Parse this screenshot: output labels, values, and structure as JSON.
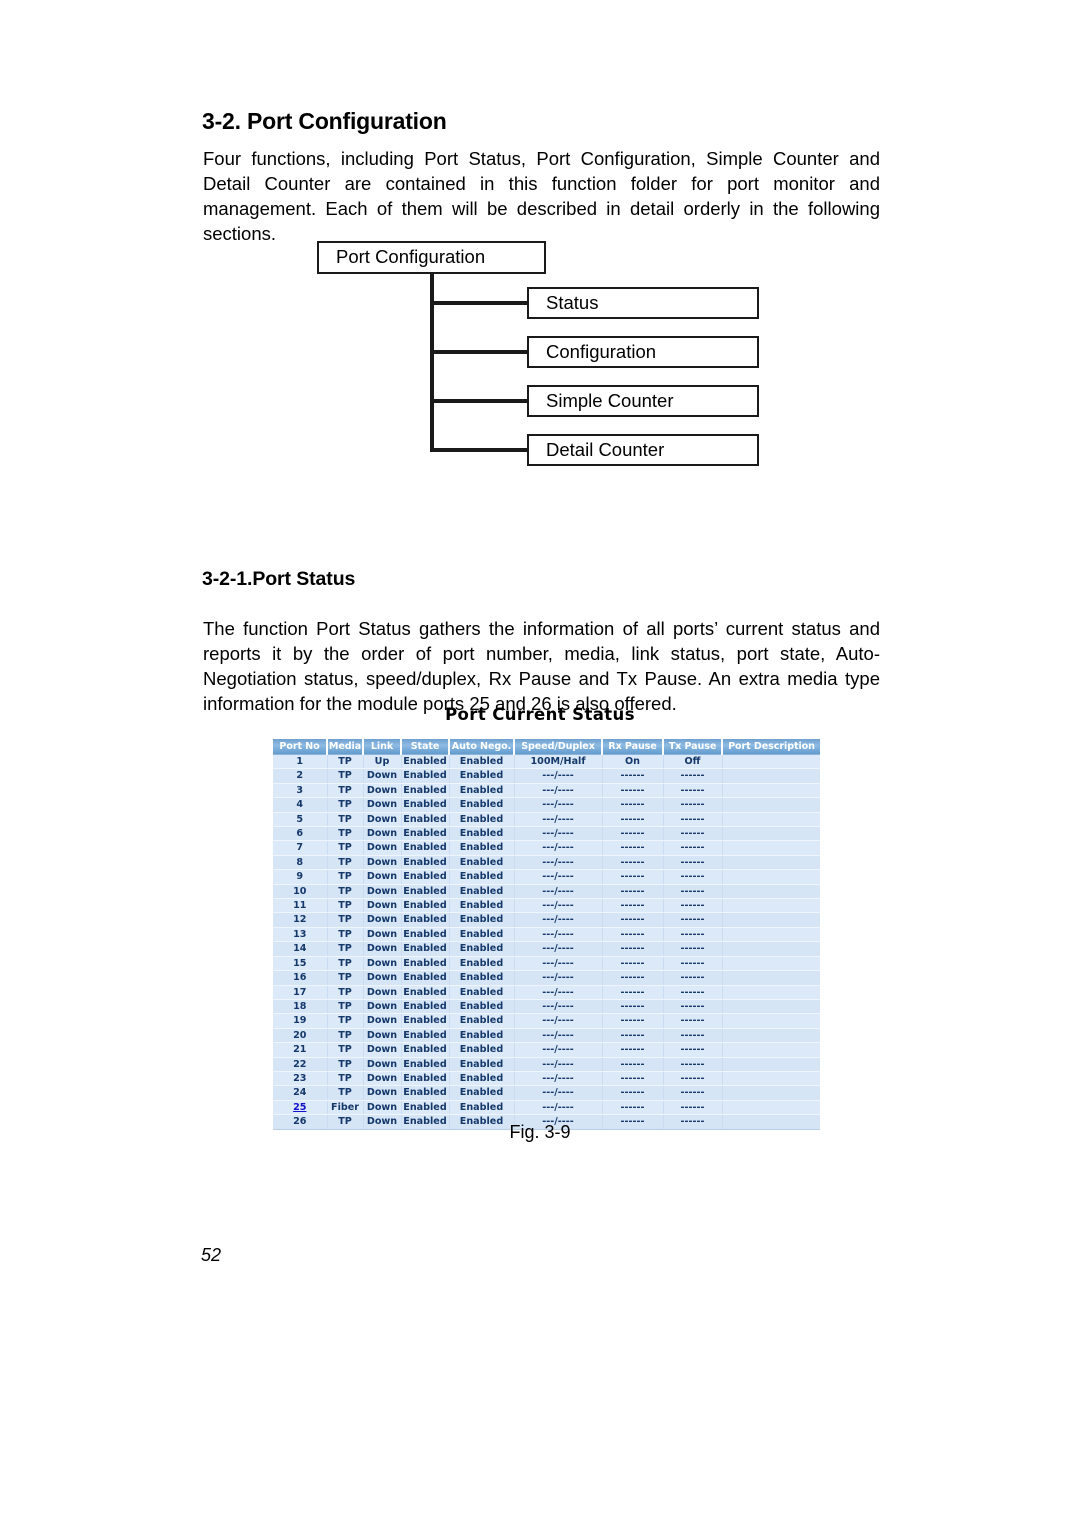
{
  "document": {
    "section_heading": "3-2. Port Configuration",
    "intro_paragraph": "Four functions, including Port Status, Port Configuration, Simple Counter and Detail Counter are contained in this function folder for port monitor and management. Each of them will be described in detail orderly in the following sections.",
    "subsection_heading": "3-2-1.Port Status",
    "status_paragraph": "The function Port Status gathers the information of all ports’ current status and reports it by the order of port number, media, link status, port state, Auto-Negotiation status, speed/duplex, Rx Pause and Tx Pause. An extra media type information for the module ports 25 and 26 is also offered.",
    "figure_caption": "Fig. 3-9",
    "page_number": "52"
  },
  "diagram": {
    "root": "Port Configuration",
    "children": [
      {
        "label": "Status"
      },
      {
        "label": "Configuration"
      },
      {
        "label": "Simple Counter"
      },
      {
        "label": "Detail Counter"
      }
    ]
  },
  "figure": {
    "title": "Port Current Status",
    "table": {
      "columns": [
        "Port No",
        "Media",
        "Link",
        "State",
        "Auto Nego.",
        "Speed/Duplex",
        "Rx Pause",
        "Tx Pause",
        "Port Description"
      ],
      "link_color": "#1111cc",
      "header_color": "#7fb0dc",
      "row_color": "#dce9f8",
      "rows": [
        {
          "port": "1",
          "media": "TP",
          "link": "Up",
          "state": "Enabled",
          "auto": "Enabled",
          "speed": "100M/Half",
          "rx": "On",
          "tx": "Off",
          "desc": "",
          "is_link": false
        },
        {
          "port": "2",
          "media": "TP",
          "link": "Down",
          "state": "Enabled",
          "auto": "Enabled",
          "speed": "---/----",
          "rx": "------",
          "tx": "------",
          "desc": "",
          "is_link": false
        },
        {
          "port": "3",
          "media": "TP",
          "link": "Down",
          "state": "Enabled",
          "auto": "Enabled",
          "speed": "---/----",
          "rx": "------",
          "tx": "------",
          "desc": "",
          "is_link": false
        },
        {
          "port": "4",
          "media": "TP",
          "link": "Down",
          "state": "Enabled",
          "auto": "Enabled",
          "speed": "---/----",
          "rx": "------",
          "tx": "------",
          "desc": "",
          "is_link": false
        },
        {
          "port": "5",
          "media": "TP",
          "link": "Down",
          "state": "Enabled",
          "auto": "Enabled",
          "speed": "---/----",
          "rx": "------",
          "tx": "------",
          "desc": "",
          "is_link": false
        },
        {
          "port": "6",
          "media": "TP",
          "link": "Down",
          "state": "Enabled",
          "auto": "Enabled",
          "speed": "---/----",
          "rx": "------",
          "tx": "------",
          "desc": "",
          "is_link": false
        },
        {
          "port": "7",
          "media": "TP",
          "link": "Down",
          "state": "Enabled",
          "auto": "Enabled",
          "speed": "---/----",
          "rx": "------",
          "tx": "------",
          "desc": "",
          "is_link": false
        },
        {
          "port": "8",
          "media": "TP",
          "link": "Down",
          "state": "Enabled",
          "auto": "Enabled",
          "speed": "---/----",
          "rx": "------",
          "tx": "------",
          "desc": "",
          "is_link": false
        },
        {
          "port": "9",
          "media": "TP",
          "link": "Down",
          "state": "Enabled",
          "auto": "Enabled",
          "speed": "---/----",
          "rx": "------",
          "tx": "------",
          "desc": "",
          "is_link": false
        },
        {
          "port": "10",
          "media": "TP",
          "link": "Down",
          "state": "Enabled",
          "auto": "Enabled",
          "speed": "---/----",
          "rx": "------",
          "tx": "------",
          "desc": "",
          "is_link": false
        },
        {
          "port": "11",
          "media": "TP",
          "link": "Down",
          "state": "Enabled",
          "auto": "Enabled",
          "speed": "---/----",
          "rx": "------",
          "tx": "------",
          "desc": "",
          "is_link": false
        },
        {
          "port": "12",
          "media": "TP",
          "link": "Down",
          "state": "Enabled",
          "auto": "Enabled",
          "speed": "---/----",
          "rx": "------",
          "tx": "------",
          "desc": "",
          "is_link": false
        },
        {
          "port": "13",
          "media": "TP",
          "link": "Down",
          "state": "Enabled",
          "auto": "Enabled",
          "speed": "---/----",
          "rx": "------",
          "tx": "------",
          "desc": "",
          "is_link": false
        },
        {
          "port": "14",
          "media": "TP",
          "link": "Down",
          "state": "Enabled",
          "auto": "Enabled",
          "speed": "---/----",
          "rx": "------",
          "tx": "------",
          "desc": "",
          "is_link": false
        },
        {
          "port": "15",
          "media": "TP",
          "link": "Down",
          "state": "Enabled",
          "auto": "Enabled",
          "speed": "---/----",
          "rx": "------",
          "tx": "------",
          "desc": "",
          "is_link": false
        },
        {
          "port": "16",
          "media": "TP",
          "link": "Down",
          "state": "Enabled",
          "auto": "Enabled",
          "speed": "---/----",
          "rx": "------",
          "tx": "------",
          "desc": "",
          "is_link": false
        },
        {
          "port": "17",
          "media": "TP",
          "link": "Down",
          "state": "Enabled",
          "auto": "Enabled",
          "speed": "---/----",
          "rx": "------",
          "tx": "------",
          "desc": "",
          "is_link": false
        },
        {
          "port": "18",
          "media": "TP",
          "link": "Down",
          "state": "Enabled",
          "auto": "Enabled",
          "speed": "---/----",
          "rx": "------",
          "tx": "------",
          "desc": "",
          "is_link": false
        },
        {
          "port": "19",
          "media": "TP",
          "link": "Down",
          "state": "Enabled",
          "auto": "Enabled",
          "speed": "---/----",
          "rx": "------",
          "tx": "------",
          "desc": "",
          "is_link": false
        },
        {
          "port": "20",
          "media": "TP",
          "link": "Down",
          "state": "Enabled",
          "auto": "Enabled",
          "speed": "---/----",
          "rx": "------",
          "tx": "------",
          "desc": "",
          "is_link": false
        },
        {
          "port": "21",
          "media": "TP",
          "link": "Down",
          "state": "Enabled",
          "auto": "Enabled",
          "speed": "---/----",
          "rx": "------",
          "tx": "------",
          "desc": "",
          "is_link": false
        },
        {
          "port": "22",
          "media": "TP",
          "link": "Down",
          "state": "Enabled",
          "auto": "Enabled",
          "speed": "---/----",
          "rx": "------",
          "tx": "------",
          "desc": "",
          "is_link": false
        },
        {
          "port": "23",
          "media": "TP",
          "link": "Down",
          "state": "Enabled",
          "auto": "Enabled",
          "speed": "---/----",
          "rx": "------",
          "tx": "------",
          "desc": "",
          "is_link": false
        },
        {
          "port": "24",
          "media": "TP",
          "link": "Down",
          "state": "Enabled",
          "auto": "Enabled",
          "speed": "---/----",
          "rx": "------",
          "tx": "------",
          "desc": "",
          "is_link": false
        },
        {
          "port": "25",
          "media": "Fiber",
          "link": "Down",
          "state": "Enabled",
          "auto": "Enabled",
          "speed": "---/----",
          "rx": "------",
          "tx": "------",
          "desc": "",
          "is_link": true
        },
        {
          "port": "26",
          "media": "TP",
          "link": "Down",
          "state": "Enabled",
          "auto": "Enabled",
          "speed": "---/----",
          "rx": "------",
          "tx": "------",
          "desc": "",
          "is_link": false
        }
      ]
    }
  }
}
